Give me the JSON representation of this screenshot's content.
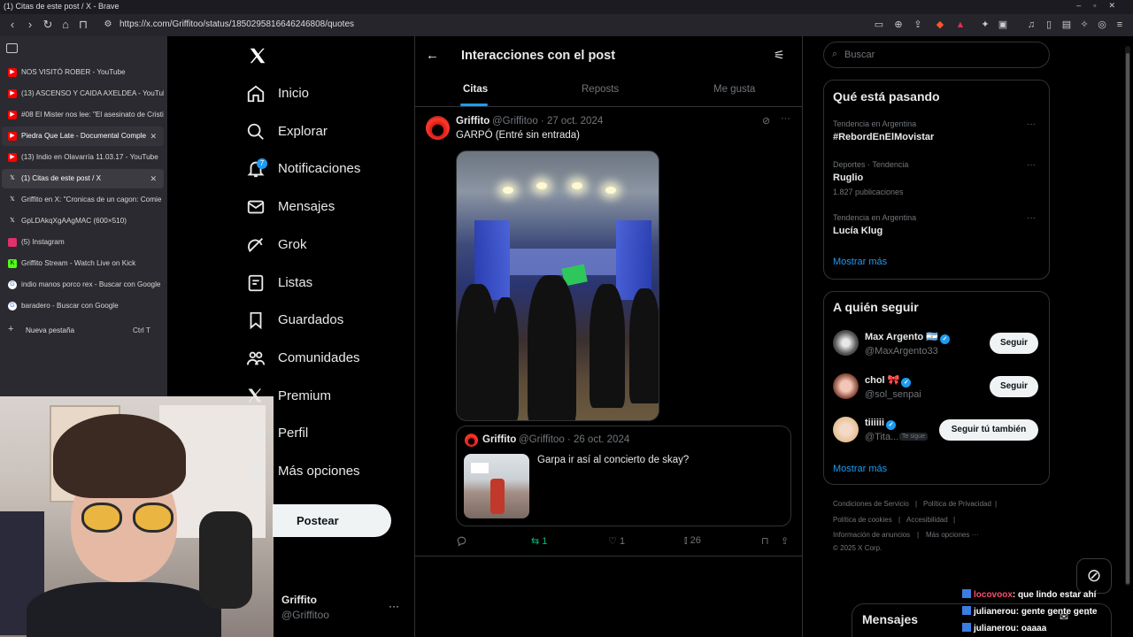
{
  "browser": {
    "window_title": "(1) Citas de este post / X - Brave",
    "url": "https://x.com/Griffitoo/status/1850295816646246808/quotes",
    "tabs": [
      {
        "title": "NOS VISITÓ ROBER - YouTube",
        "icon": "youtube-icon",
        "color": "#ff0000"
      },
      {
        "title": "(13) ASCENSO Y CAIDA AXELDEA - YouTube",
        "icon": "youtube-icon",
        "color": "#ff0000"
      },
      {
        "title": "#08 El Mister nos lee: \"El asesinato de Cristi",
        "icon": "youtube-icon",
        "color": "#ff0000"
      },
      {
        "title": "Piedra Que Late - Documental Comple",
        "icon": "youtube-icon",
        "color": "#ff0000"
      },
      {
        "title": "(13) Indio en Olavarría 11.03.17 - YouTube",
        "icon": "youtube-icon",
        "color": "#ff0000"
      },
      {
        "title": "(1) Citas de este post / X",
        "icon": "x-icon",
        "color": "#000000"
      },
      {
        "title": "Griffito en X: \"Cronicas de un cagon: Comie",
        "icon": "x-icon",
        "color": "#000000"
      },
      {
        "title": "GpLDAkqXgAAgMAC (600×510)",
        "icon": "x-icon",
        "color": "#000000"
      },
      {
        "title": "(5) Instagram",
        "icon": "instagram-icon",
        "color": "#e1306c"
      },
      {
        "title": "Griffito Stream - Watch Live on Kick",
        "icon": "kick-icon",
        "color": "#53fc18"
      },
      {
        "title": "indio manos porco rex - Buscar con Google",
        "icon": "google-icon",
        "color": "#ffffff"
      },
      {
        "title": "baradero - Buscar con Google",
        "icon": "google-icon",
        "color": "#ffffff"
      }
    ],
    "new_tab_label": "Nueva pestaña",
    "new_tab_shortcut": "Ctrl T"
  },
  "nav": {
    "items": [
      {
        "label": "Inicio",
        "icon": "home-icon"
      },
      {
        "label": "Explorar",
        "icon": "search-icon"
      },
      {
        "label": "Notificaciones",
        "icon": "bell-icon"
      },
      {
        "label": "Mensajes",
        "icon": "mail-icon"
      },
      {
        "label": "Grok",
        "icon": "grok-icon"
      },
      {
        "label": "Listas",
        "icon": "list-icon"
      },
      {
        "label": "Guardados",
        "icon": "bookmark-icon"
      },
      {
        "label": "Comunidades",
        "icon": "people-icon"
      },
      {
        "label": "Premium",
        "icon": "x-icon"
      },
      {
        "label": "Perfil",
        "icon": "profile-icon"
      },
      {
        "label": "Más opciones",
        "icon": "more-icon"
      }
    ],
    "notif_count": "7",
    "post_button": "Postear",
    "account_name": "Griffito",
    "account_handle": "@Griffitoo"
  },
  "header": {
    "title": "Interacciones con el post",
    "tabs": [
      "Citas",
      "Reposts",
      "Me gusta"
    ]
  },
  "post": {
    "name": "Griffito",
    "handle_date": "@Griffitoo · 27 oct. 2024",
    "text": "GARPÓ (Entré sin entrada)",
    "quoted": {
      "name": "Griffito",
      "handle_date": "@Griffitoo · 26 oct. 2024",
      "text": "Garpa ir así al concierto de skay?"
    },
    "actions": {
      "replies": "",
      "reposts": "1",
      "likes": "1",
      "views": "26"
    }
  },
  "sidebar": {
    "search_placeholder": "Buscar",
    "trends_title": "Qué está pasando",
    "trends": [
      {
        "context": "Tendencia en Argentina",
        "name": "#RebordEnElMovistar",
        "count": ""
      },
      {
        "context": "Deportes · Tendencia",
        "name": "Ruglio",
        "count": "1.827 publicaciones"
      },
      {
        "context": "Tendencia en Argentina",
        "name": "Lucía Klug",
        "count": ""
      }
    ],
    "show_more": "Mostrar más",
    "who_title": "A quién seguir",
    "who": [
      {
        "name": "Max Argento 🇦🇷",
        "handle": "@MaxArgento33",
        "button": "Seguir"
      },
      {
        "name": "chol 🎀",
        "handle": "@sol_senpai",
        "button": "Seguir"
      },
      {
        "name": "tiiiiii",
        "handle": "@Tita...",
        "button": "Seguir tú también",
        "badge": "Te sigue"
      }
    ],
    "footer": {
      "terms": "Condiciones de Servicio",
      "privacy": "Política de Privacidad",
      "cookies": "Política de cookies",
      "accessibility": "Accesibilidad",
      "ads": "Información de anuncios",
      "more": "Más opciones ···",
      "copyright": "© 2025 X Corp."
    }
  },
  "messages": {
    "title": "Mensajes"
  },
  "chat": [
    {
      "user": "locovoox",
      "user_color": "#ff4d6d",
      "text": ": que lindo estar ahí"
    },
    {
      "user": "julianerou",
      "user_color": "#ffffff",
      "text": ": gente gente gente"
    },
    {
      "user": "julianerou",
      "user_color": "#ffffff",
      "text": ": oaaaa"
    }
  ],
  "colors": {
    "accent": "#1d9bf0",
    "repost": "#00ba7c",
    "background": "#000000"
  }
}
